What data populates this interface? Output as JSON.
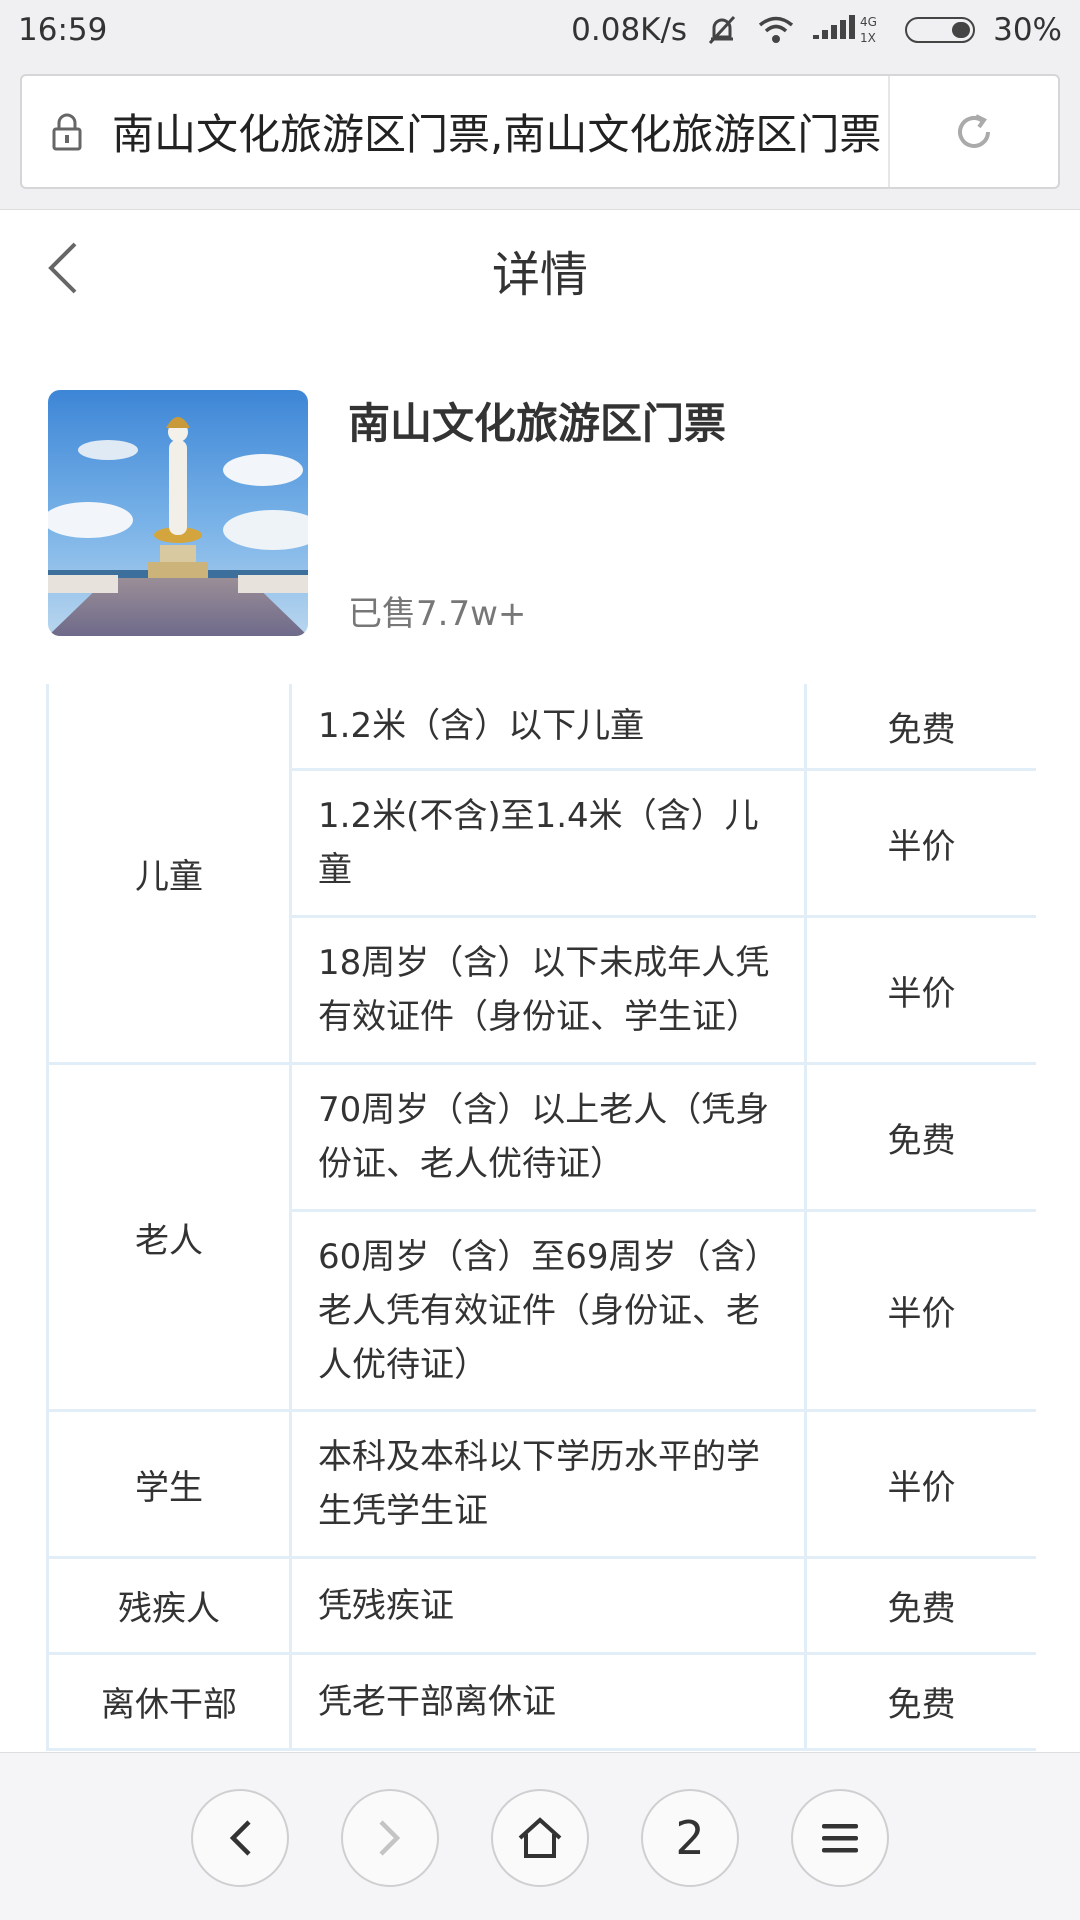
{
  "status_bar": {
    "time": "16:59",
    "network_speed": "0.08K/s",
    "network_type_top": "4G",
    "network_type_bottom": "1X",
    "battery": "30%",
    "icons": [
      "mute-icon",
      "wifi-icon",
      "signal-icon",
      "battery-icon"
    ]
  },
  "browser": {
    "url_text": "南山文化旅游区门票,南山文化旅游区门票",
    "tab_count": "2"
  },
  "header": {
    "title": "详情"
  },
  "product": {
    "name": "南山文化旅游区门票",
    "sold": "已售7.7w+"
  },
  "policy_table": {
    "groups": [
      {
        "category": "儿童",
        "rows": [
          {
            "condition": "1.2米（含）以下儿童",
            "price": "免费"
          },
          {
            "condition": "1.2米(不含)至1.4米（含）儿童",
            "price": "半价"
          },
          {
            "condition": "18周岁（含）以下未成年人凭有效证件（身份证、学生证）",
            "price": "半价"
          }
        ]
      },
      {
        "category": "老人",
        "rows": [
          {
            "condition": "70周岁（含）以上老人（凭身份证、老人优待证）",
            "price": "免费"
          },
          {
            "condition": "60周岁（含）至69周岁（含）老人凭有效证件（身份证、老人优待证）",
            "price": "半价"
          }
        ]
      },
      {
        "category": "学生",
        "rows": [
          {
            "condition": "本科及本科以下学历水平的学生凭学生证",
            "price": "半价"
          }
        ]
      },
      {
        "category": "残疾人",
        "rows": [
          {
            "condition": "凭残疾证",
            "price": "免费"
          }
        ]
      },
      {
        "category": "离休干部",
        "rows": [
          {
            "condition": "凭老干部离休证",
            "price": "免费"
          }
        ]
      }
    ]
  },
  "bottom_nav": {
    "items": [
      "back-icon",
      "forward-icon",
      "home-icon",
      "tabs-count",
      "menu-icon"
    ]
  }
}
